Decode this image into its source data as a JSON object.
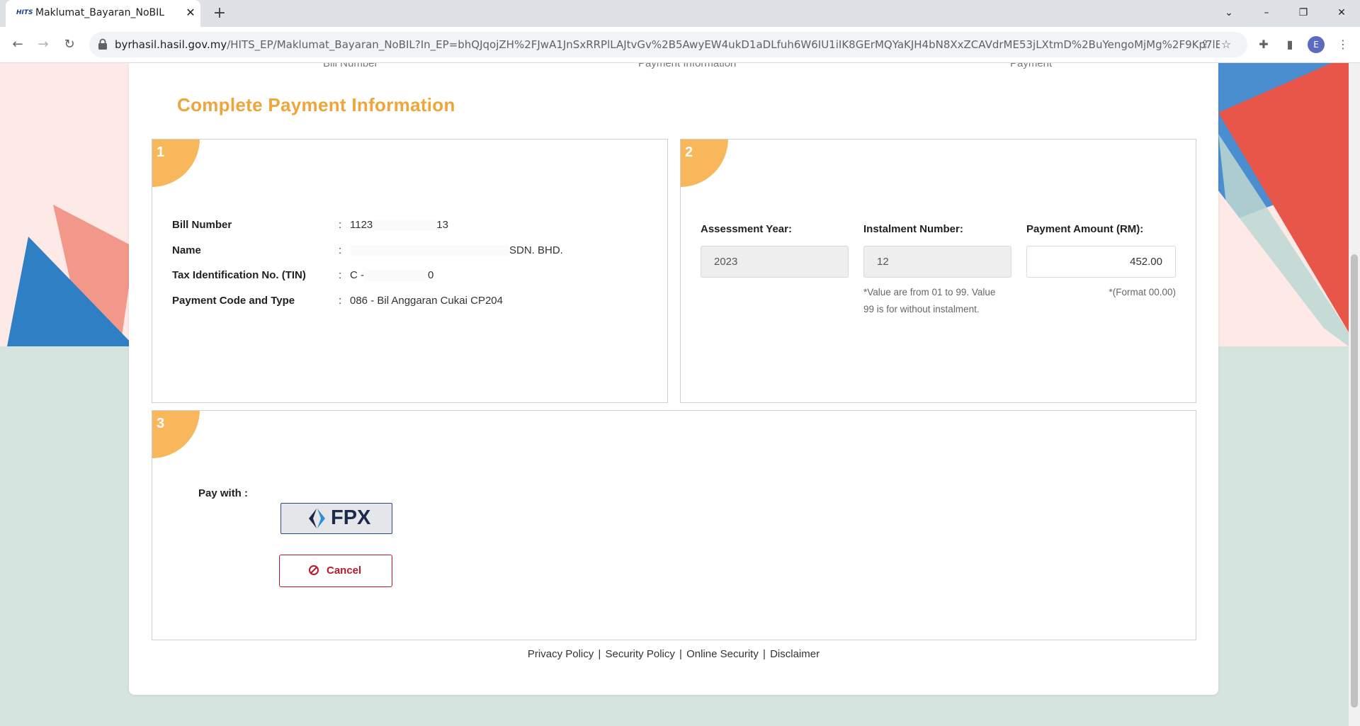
{
  "browser": {
    "tab_title": "Maklumat_Bayaran_NoBIL",
    "favicon_text": "HITS",
    "url_host": "byrhasil.hasil.gov.my",
    "url_path": "/HITS_EP/Maklumat_Bayaran_NoBIL?In_EP=bhQJqojZH%2FJwA1JnSxRRPlLAJtvGv%2B5AwyEW4ukD1aDLfuh6W6IU1iIK8GErMQYaKJH4bN8XxZCAVdrME53jLXtmD%2BuYengoMjMg%2F9Kp7lE%3...",
    "avatar_letter": "E"
  },
  "steps": [
    "Bill Number",
    "Payment Information",
    "Payment"
  ],
  "heading": "Complete Payment Information",
  "panel1": {
    "number": "1",
    "rows": [
      {
        "label": "Bill Number",
        "colon": ":",
        "value_prefix": "1123",
        "value_suffix": "13"
      },
      {
        "label": "Name",
        "colon": ":",
        "value_prefix": "",
        "value_suffix": "SDN. BHD."
      },
      {
        "label": "Tax Identification No. (TIN)",
        "colon": ":",
        "value_prefix": "C -",
        "value_suffix": "0"
      },
      {
        "label": "Payment Code and Type",
        "colon": ":",
        "value_prefix": "086 - Bil Anggaran Cukai CP204",
        "value_suffix": ""
      }
    ]
  },
  "panel2": {
    "number": "2",
    "assessment_year_label": "Assessment Year:",
    "assessment_year_value": "2023",
    "instalment_label": "Instalment Number:",
    "instalment_value": "12",
    "instalment_hint_1": "*Value are from 01 to 99. Value",
    "instalment_hint_2": "99 is for without instalment.",
    "amount_label": "Payment Amount (RM):",
    "amount_value": "452.00",
    "amount_hint": "*(Format 00.00)"
  },
  "panel3": {
    "number": "3",
    "pay_with_label": "Pay with  :",
    "fpx_label": "FPX",
    "cancel_label": "Cancel"
  },
  "footer": {
    "links": [
      "Privacy Policy",
      "Security Policy",
      "Online Security",
      "Disclaimer"
    ],
    "separator": "|"
  },
  "colors": {
    "accent_orange": "#f0a53a",
    "badge_orange": "#f9b75c",
    "cancel_red": "#b31b2c",
    "fpx_navy": "#1b2a4a"
  }
}
